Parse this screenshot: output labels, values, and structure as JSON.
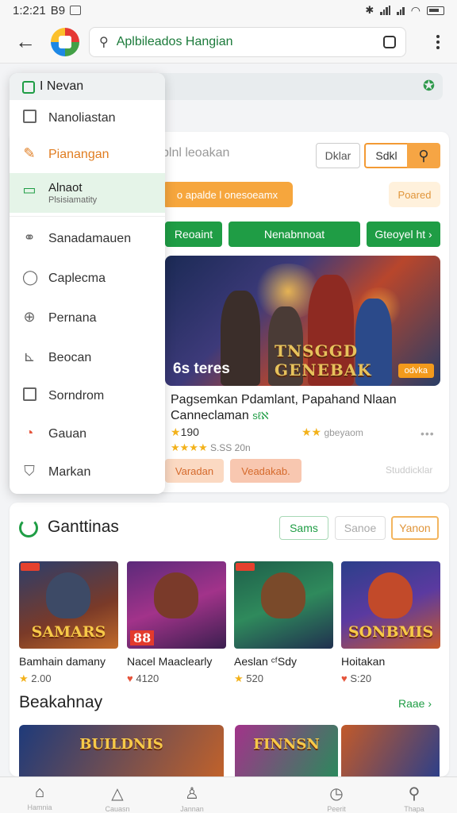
{
  "status_bar": {
    "time": "1:2:21",
    "carrier": "B9"
  },
  "search": {
    "query": "Aplbileados Hangian"
  },
  "main_card": {
    "input_text": "blnl leoakan",
    "clear_label": "Dklar",
    "start_label": "Sdkl",
    "promo_text": "o apalde l onesoeamx",
    "posted_label": "Poared",
    "filters": [
      "Reoaint",
      "Nenabnnoat",
      "Gteoyel ht ›"
    ],
    "hero": {
      "count_text": "6s teres",
      "badge_text": "odvka",
      "title_art": "TNSGGD GENEBAK"
    },
    "title": "Pagsemkan Pdamlant, Papahand Nlaan Canneclaman",
    "verified_mark": "sℓℵ",
    "rating": "190",
    "meta": "S.SS 20n",
    "rating2": "gbeyaom",
    "more": "•••",
    "actions": [
      "Varadan",
      "Veadakab."
    ],
    "faint_link": "Studdicklar"
  },
  "menu": {
    "header": "I Nevan",
    "items": [
      {
        "label": "Nanoliastan",
        "icon": "checkbox-icon"
      },
      {
        "label": "Pianangan",
        "icon": "edit-icon"
      },
      {
        "label": "Alnaot",
        "sub": "Plsisiamatity",
        "icon": "tablet-icon"
      },
      {
        "label": "Sanadamauen",
        "icon": "link-icon"
      },
      {
        "label": "Caplecma",
        "icon": "chat-icon"
      },
      {
        "label": "Pernana",
        "icon": "globe-icon"
      },
      {
        "label": "Beocan",
        "icon": "chart-icon"
      },
      {
        "label": "Sorndrom",
        "icon": "square-icon"
      },
      {
        "label": "Gauan",
        "icon": "gauge-icon"
      },
      {
        "label": "Markan",
        "icon": "shield-icon"
      }
    ]
  },
  "section2": {
    "title": "Ganttinas",
    "pills": [
      "Sams",
      "Sanoe",
      "Yanon"
    ],
    "tiles": [
      {
        "art": "SAMARS",
        "name": "Bamhain damany",
        "rating": "2.00",
        "rating_icon": "star"
      },
      {
        "art": "88",
        "name": "Nacel Maaclearly",
        "rating": "4120",
        "rating_icon": "heart"
      },
      {
        "art": "",
        "name": "Aeslan ᶜᶠSdy",
        "rating": "520",
        "rating_icon": "star"
      },
      {
        "art": "SONBMIS",
        "name": "Hoitakan",
        "rating": "S:20",
        "rating_icon": "heart"
      }
    ],
    "section3_title": "Beakahnay",
    "section3_more": "Raae ›",
    "strips": [
      "BUILDNIS",
      "FINNSN",
      ""
    ]
  },
  "bottom_nav": [
    "Hamnia",
    "Cauasn",
    "Jannan",
    "Peerit",
    "Thapa"
  ],
  "colors": {
    "accent_green": "#1f9d45",
    "accent_orange": "#f39a34"
  }
}
